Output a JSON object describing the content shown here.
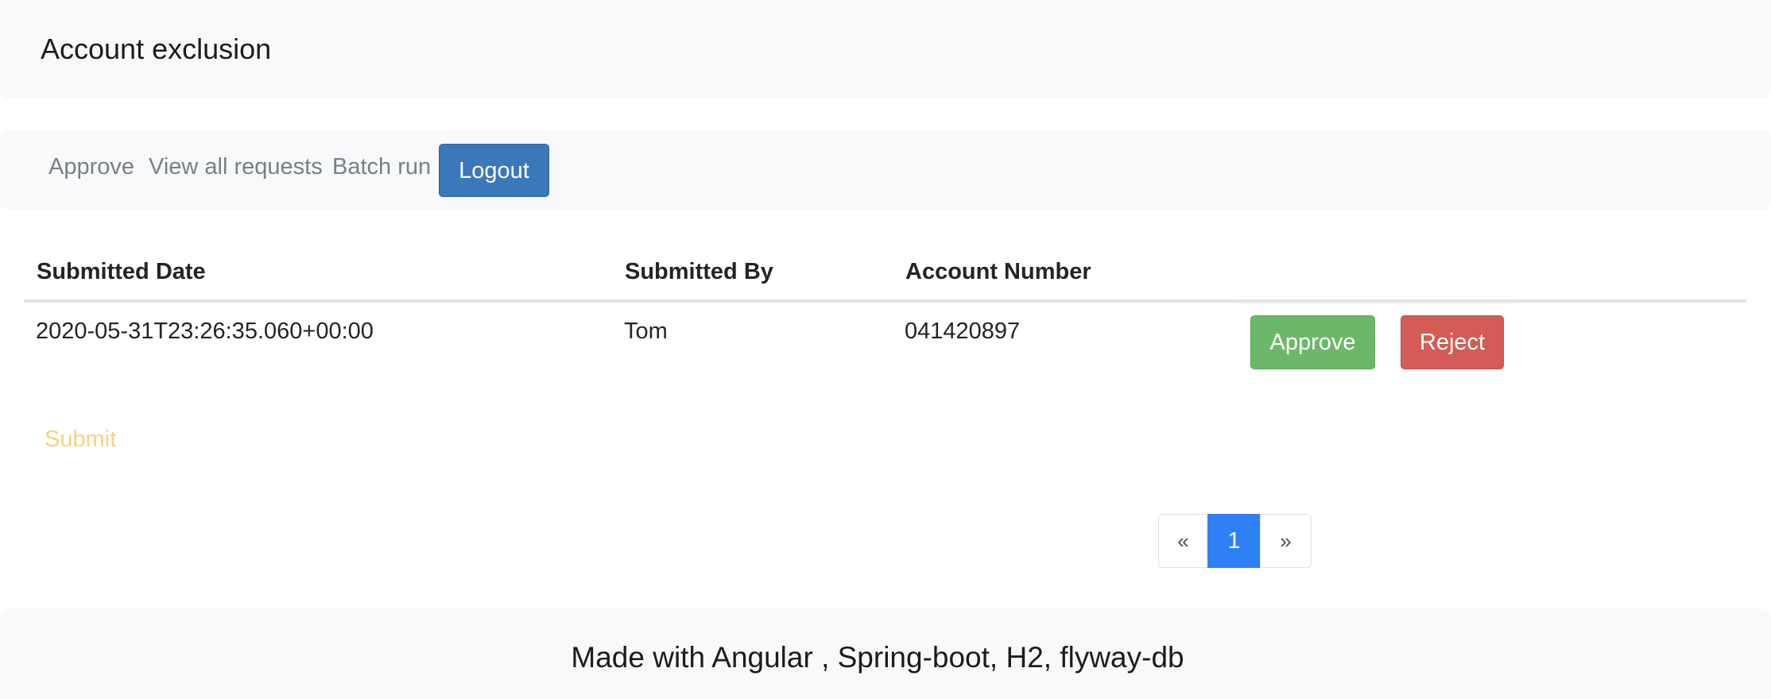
{
  "header": {
    "title": "Account exclusion"
  },
  "nav": {
    "links": [
      "Approve",
      "View all requests",
      "Batch run"
    ],
    "logout_label": "Logout"
  },
  "table": {
    "columns": [
      "Submitted Date",
      "Submitted By",
      "Account Number"
    ],
    "rows": [
      {
        "submitted_date": "2020-05-31T23:26:35.060+00:00",
        "submitted_by": "Tom",
        "account_number": "041420897",
        "approve_label": "Approve",
        "reject_label": "Reject"
      }
    ]
  },
  "submit_label": "Submit",
  "pagination": {
    "prev": "«",
    "current": "1",
    "next": "»"
  },
  "footer": {
    "text": "Made with Angular , Spring-boot, H2, flyway-db"
  },
  "colors": {
    "primary": "#3a78b9",
    "success": "#6cb86a",
    "danger": "#d45c56",
    "warning_link": "#f8d27a",
    "page_active": "#2f80f6"
  }
}
